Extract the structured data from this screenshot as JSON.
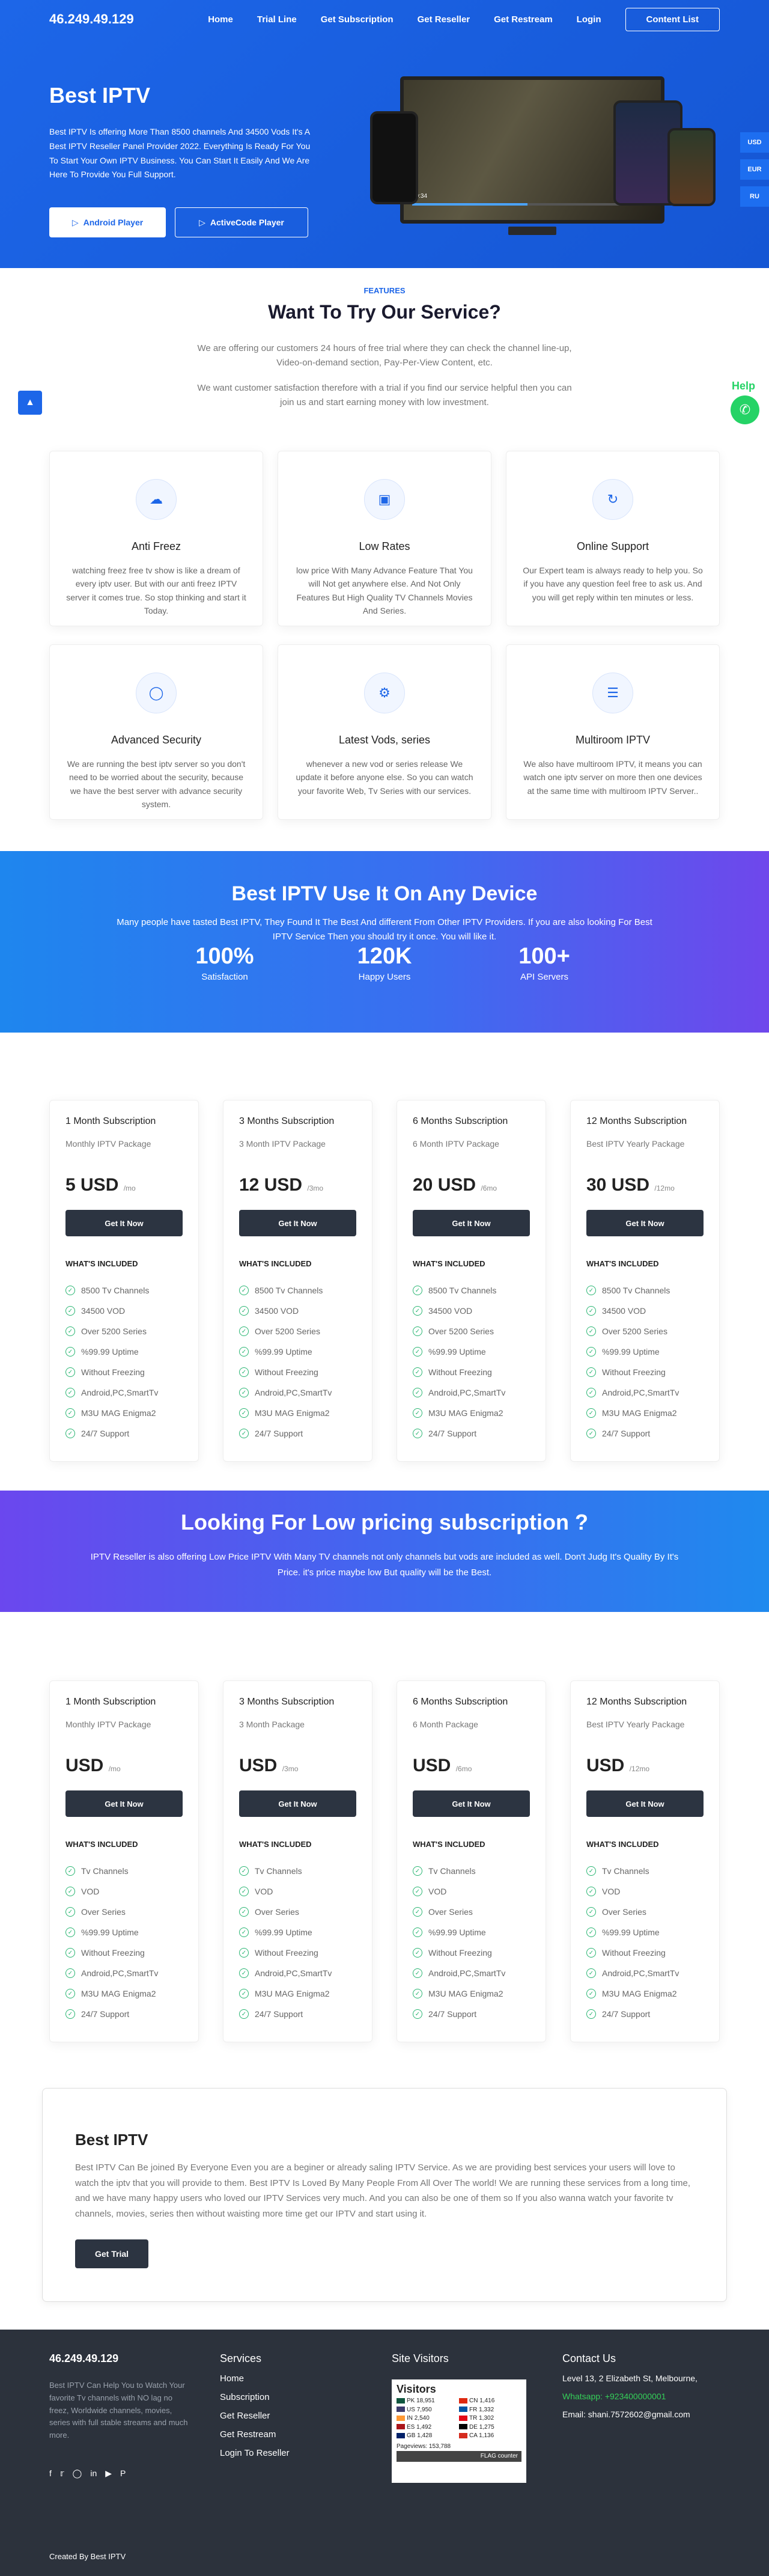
{
  "nav": {
    "brand": "46.249.49.129",
    "items": [
      "Home",
      "Trial Line",
      "Get Subscription",
      "Get Reseller",
      "Get Restream",
      "Login"
    ],
    "content_btn": "Content List"
  },
  "hero": {
    "title": "Best IPTV",
    "text": "Best IPTV Is offering More Than 8500 channels And 34500 Vods It's A Best IPTV Reseller Panel Provider 2022. Everything Is Ready For You To Start Your Own IPTV Business. You Can Start It Easily And We Are Here To Provide You Full Support.",
    "btn_android": "Android Player",
    "btn_active": "ActiveCode Player",
    "player_time": "00:34"
  },
  "currency": [
    "USD",
    "EUR",
    "RU"
  ],
  "help_label": "Help",
  "features": {
    "tag": "FEATURES",
    "title": "Want To Try Our Service?",
    "intro1": "We are offering our customers 24 hours of free trial where they can check the channel line-up, Video-on-demand section, Pay-Per-View Content, etc.",
    "intro2": "We want customer satisfaction therefore with a trial if you find our service helpful then you can join us and start earning money with low investment.",
    "cards": [
      {
        "title": "Anti Freez",
        "text": "watching freez free tv show is like a dream of every iptv user. But with our anti freez IPTV server it comes true. So stop thinking and start it Today."
      },
      {
        "title": "Low Rates",
        "text": "low price With Many Advance Feature That You will Not get anywhere else. And Not Only Features But High Quality TV Channels Movies And Series."
      },
      {
        "title": "Online Support",
        "text": "Our Expert team is always ready to help you. So if you have any question feel free to ask us. And you will get reply within ten minutes or less."
      },
      {
        "title": "Advanced Security",
        "text": "We are running the best iptv server so you don't need to be worried about the security, because we have the best server with advance security system."
      },
      {
        "title": "Latest Vods, series",
        "text": "whenever a new vod or series release We update it before anyone else. So you can watch your favorite Web, Tv Series with our services."
      },
      {
        "title": "Multiroom IPTV",
        "text": "We also have multiroom IPTV, it means you can watch one iptv server on more then one devices at the same time with multiroom IPTV Server.."
      }
    ]
  },
  "stats": {
    "title": "Best IPTV Use It On Any Device",
    "text": "Many people have tasted Best IPTV, They Found It The Best And different From Other IPTV Providers. If you are also looking For Best IPTV Service Then you should try it once. You will like it.",
    "items": [
      {
        "value": "100%",
        "label": "Satisfaction"
      },
      {
        "value": "120K",
        "label": "Happy Users"
      },
      {
        "value": "100+",
        "label": "API Servers"
      }
    ]
  },
  "plans": [
    {
      "name": "1 Month Subscription",
      "type": "Monthly IPTV Package",
      "price": "5 USD",
      "per": "/mo"
    },
    {
      "name": "3 Months Subscription",
      "type": "3 Month IPTV Package",
      "price": "12 USD",
      "per": "/3mo"
    },
    {
      "name": "6 Months Subscription",
      "type": "6 Month IPTV Package",
      "price": "20 USD",
      "per": "/6mo"
    },
    {
      "name": "12 Months Subscription",
      "type": "Best IPTV Yearly Package",
      "price": "30 USD",
      "per": "/12mo"
    }
  ],
  "plan_features": [
    "8500 Tv Channels",
    "34500 VOD",
    "Over 5200 Series",
    "%99.99 Uptime",
    "Without Freezing",
    "Android,PC,SmartTv",
    "M3U MAG Enigma2",
    "24/7 Support"
  ],
  "get_label": "Get It Now",
  "included_label": "WHAT'S INCLUDED",
  "lowprice": {
    "title": "Looking For Low pricing subscription ?",
    "text": "IPTV Reseller is also offering Low Price IPTV With Many TV channels not only channels but vods are included as well. Don't Judg It's Quality By It's Price. it's price maybe low But quality will be the Best."
  },
  "plans2": [
    {
      "name": "1 Month Subscription",
      "type": "Monthly IPTV Package",
      "price": "USD",
      "per": "/mo"
    },
    {
      "name": "3 Months Subscription",
      "type": "3 Month Package",
      "price": "USD",
      "per": "/3mo"
    },
    {
      "name": "6 Months Subscription",
      "type": "6 Month Package",
      "price": "USD",
      "per": "/6mo"
    },
    {
      "name": "12 Months Subscription",
      "type": "Best IPTV Yearly Package",
      "price": "USD",
      "per": "/12mo"
    }
  ],
  "plan2_features": [
    "Tv Channels",
    "VOD",
    "Over Series",
    "%99.99 Uptime",
    "Without Freezing",
    "Android,PC,SmartTv",
    "M3U MAG Enigma2",
    "24/7 Support"
  ],
  "trial": {
    "title": "Best IPTV",
    "text": "Best IPTV Can Be joined By Everyone Even you are a beginer or already saling IPTV Service. As we are providing best services your users will love to watch the iptv that you will provide to them. Best IPTV Is Loved By Many People From All Over The world! We are running these services from a long time, and we have many happy users who loved our IPTV Services very much. And you can also be one of them so If you also wanna watch your favorite tv channels, movies, series then without waisting more time get our IPTV and start using it.",
    "btn": "Get Trial"
  },
  "footer": {
    "brand": "46.249.49.129",
    "text": "Best IPTV Can Help You to Watch Your favorite Tv channels with NO lag no freez, Worldwide channels, movies, series with full stable streams and much more.",
    "social_icons": [
      "facebook-icon",
      "twitter-icon",
      "instagram-icon",
      "linkedin-icon",
      "youtube-icon",
      "pinterest-icon"
    ],
    "services_title": "Services",
    "services": [
      "Home",
      "Subscription",
      "Get Reseller",
      "Get Restream",
      "Login To Reseller"
    ],
    "visitors_title": "Site Visitors",
    "counter_title": "Visitors",
    "counter": [
      {
        "cc": "PK",
        "n": "18,951",
        "color": "#115740"
      },
      {
        "cc": "CN",
        "n": "1,416",
        "color": "#de2910"
      },
      {
        "cc": "US",
        "n": "7,950",
        "color": "#3c3b6e"
      },
      {
        "cc": "FR",
        "n": "1,332",
        "color": "#0055a4"
      },
      {
        "cc": "IN",
        "n": "2,540",
        "color": "#ff9933"
      },
      {
        "cc": "TR",
        "n": "1,302",
        "color": "#e30a17"
      },
      {
        "cc": "ES",
        "n": "1,492",
        "color": "#aa151b"
      },
      {
        "cc": "DE",
        "n": "1,275",
        "color": "#000000"
      },
      {
        "cc": "GB",
        "n": "1,428",
        "color": "#012169"
      },
      {
        "cc": "CA",
        "n": "1,136",
        "color": "#d52b1e"
      }
    ],
    "pageviews": "Pageviews: 153,788",
    "flag_counter": "FLAG counter",
    "contact_title": "Contact Us",
    "address": "Level 13, 2 Elizabeth St, Melbourne,",
    "whatsapp": "Whatsapp: +923400000001",
    "email": "Email: shani.7572602@gmail.com",
    "copyright": "Created By Best IPTV"
  }
}
